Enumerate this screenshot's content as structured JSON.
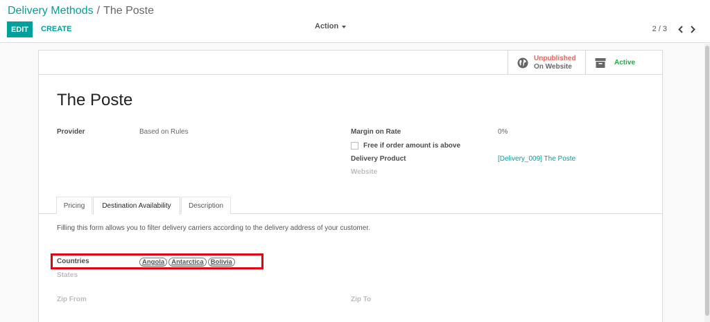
{
  "breadcrumb": {
    "parent": "Delivery Methods",
    "separator": "/",
    "current": "The Poste"
  },
  "toolbar": {
    "edit_label": "EDIT",
    "create_label": "CREATE",
    "action_label": "Action"
  },
  "pager": {
    "value": "2 / 3"
  },
  "smart_buttons": {
    "website": {
      "status": "Unpublished",
      "label": "On Website",
      "icon": "globe-icon"
    },
    "active": {
      "label": "Active",
      "icon": "archive-icon"
    }
  },
  "record": {
    "title": "The Poste"
  },
  "fields": {
    "provider_label": "Provider",
    "provider_value": "Based on Rules",
    "margin_label": "Margin on Rate",
    "margin_value": "0%",
    "free_label": "Free if order amount is above",
    "product_label": "Delivery Product",
    "product_value": "[Delivery_009] The Poste",
    "website_label": "Website"
  },
  "tabs": [
    {
      "label": "Pricing",
      "active": false
    },
    {
      "label": "Destination Availability",
      "active": true
    },
    {
      "label": "Description",
      "active": false
    }
  ],
  "destination": {
    "help_text": "Filling this form allows you to filter delivery carriers according to the delivery address of your customer.",
    "countries_label": "Countries",
    "countries": [
      "Angola",
      "Antarctica",
      "Bolivia"
    ],
    "states_label": "States",
    "zip_from_label": "Zip From",
    "zip_to_label": "Zip To"
  },
  "colors": {
    "primary": "#00a09d",
    "danger": "#e4665c",
    "success": "#28a745",
    "highlight": "#e3000f"
  }
}
